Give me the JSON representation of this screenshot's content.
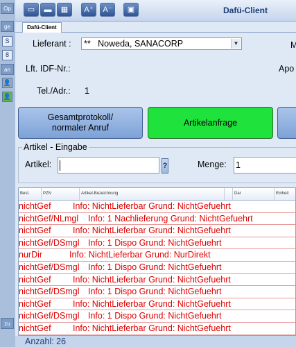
{
  "left_strip": {
    "tabs": [
      "Op",
      "ge",
      "an",
      "zu"
    ],
    "boxes": [
      "S",
      "8"
    ]
  },
  "window": {
    "title": "Dafü-Client",
    "toolbar_icons": [
      "window-icon",
      "folder-icon",
      "grid-icon",
      "font-up-icon",
      "font-down-icon",
      "monitor-icon"
    ],
    "tab": "Dafü-Client"
  },
  "form": {
    "lieferant_label": "Lieferant :",
    "lieferant_value": "**   Noweda, SANACORP",
    "right_clip_1": "M",
    "lft_idf_label": "Lft. IDF-Nr.:",
    "right_clip_2": "Apo",
    "tel_label": "Tel./Adr.:",
    "tel_value": "1"
  },
  "buttons": {
    "gesamt_line1": "Gesamtprotokoll/",
    "gesamt_line2": "normaler Anruf",
    "artikelanfrage": "Artikelanfrage"
  },
  "artikel_eingabe": {
    "group_title": "Artikel - Eingabe",
    "artikel_label": "Artikel:",
    "artikel_value": "",
    "help_label": "?",
    "menge_label": "Menge:",
    "menge_value": "1"
  },
  "grid": {
    "columns": [
      "Best.",
      "PZN",
      "Artikel-Bezeichnung",
      "Dar",
      "Einheit"
    ],
    "rows": [
      {
        "status": "nichtGef",
        "info": "Info: NichtLieferbar Grund: NichtGefuehrt"
      },
      {
        "status": "nichtGef/NLmgl",
        "info": "Info: 1 Nachlieferung Grund: NichtGefuehrt"
      },
      {
        "status": "nichtGef",
        "info": "Info: NichtLieferbar Grund: NichtGefuehrt"
      },
      {
        "status": "nichtGef/DSmgl",
        "info": "Info: 1 Dispo Grund: NichtGefuehrt"
      },
      {
        "status": "nurDir",
        "info": "Info: NichtLieferbar Grund: NurDirekt"
      },
      {
        "status": "nichtGef/DSmgl",
        "info": "Info: 1 Dispo Grund: NichtGefuehrt"
      },
      {
        "status": "nichtGef",
        "info": "Info: NichtLieferbar Grund: NichtGefuehrt"
      },
      {
        "status": "nichtGef/DSmgl",
        "info": "Info: 1 Dispo Grund: NichtGefuehrt"
      },
      {
        "status": "nichtGef",
        "info": "Info: NichtLieferbar Grund: NichtGefuehrt"
      },
      {
        "status": "nichtGef/DSmgl",
        "info": "Info: 1 Dispo Grund: NichtGefuehrt"
      },
      {
        "status": "nichtGef",
        "info": "Info: NichtLieferbar Grund: NichtGefuehrt"
      }
    ]
  },
  "status": {
    "anzahl": "Anzahl: 26"
  },
  "colors": {
    "row_text": "#e00000",
    "artikelanfrage_bg": "#1fe23c",
    "title": "#1b3a78"
  }
}
